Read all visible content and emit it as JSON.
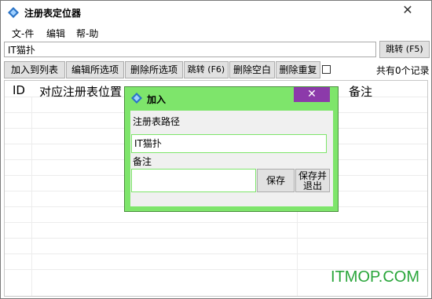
{
  "window": {
    "title": "注册表定位器",
    "close_glyph": "✕"
  },
  "menu": [
    "文-件",
    "编辑",
    "帮-助"
  ],
  "path": {
    "value": "IT猫扑",
    "jump_label": "跳转 (F5)"
  },
  "toolbar": {
    "buttons": [
      "加入到列表",
      "编辑所选项",
      "删除所选项",
      "跳转 (F6)",
      "删除空白",
      "删除重复"
    ],
    "count_text": "共有0个记录"
  },
  "list": {
    "columns": [
      "ID",
      "对应注册表位置",
      "备注"
    ]
  },
  "watermark": "ITMOP.COM",
  "dialog": {
    "title": "加入",
    "close_glyph": "✕",
    "path_label": "注册表路径",
    "path_value": "IT猫扑",
    "note_label": "备注",
    "note_value": "",
    "save_label": "保存",
    "save_exit_label": "保存并退出"
  },
  "colors": {
    "dialog_bg": "#7ee56b",
    "dialog_close_bg": "#8c3aaa",
    "watermark": "#2aa63b"
  },
  "icons": [
    "app-icon",
    "close-icon",
    "dialog-app-icon",
    "dialog-close-icon",
    "checkbox"
  ]
}
